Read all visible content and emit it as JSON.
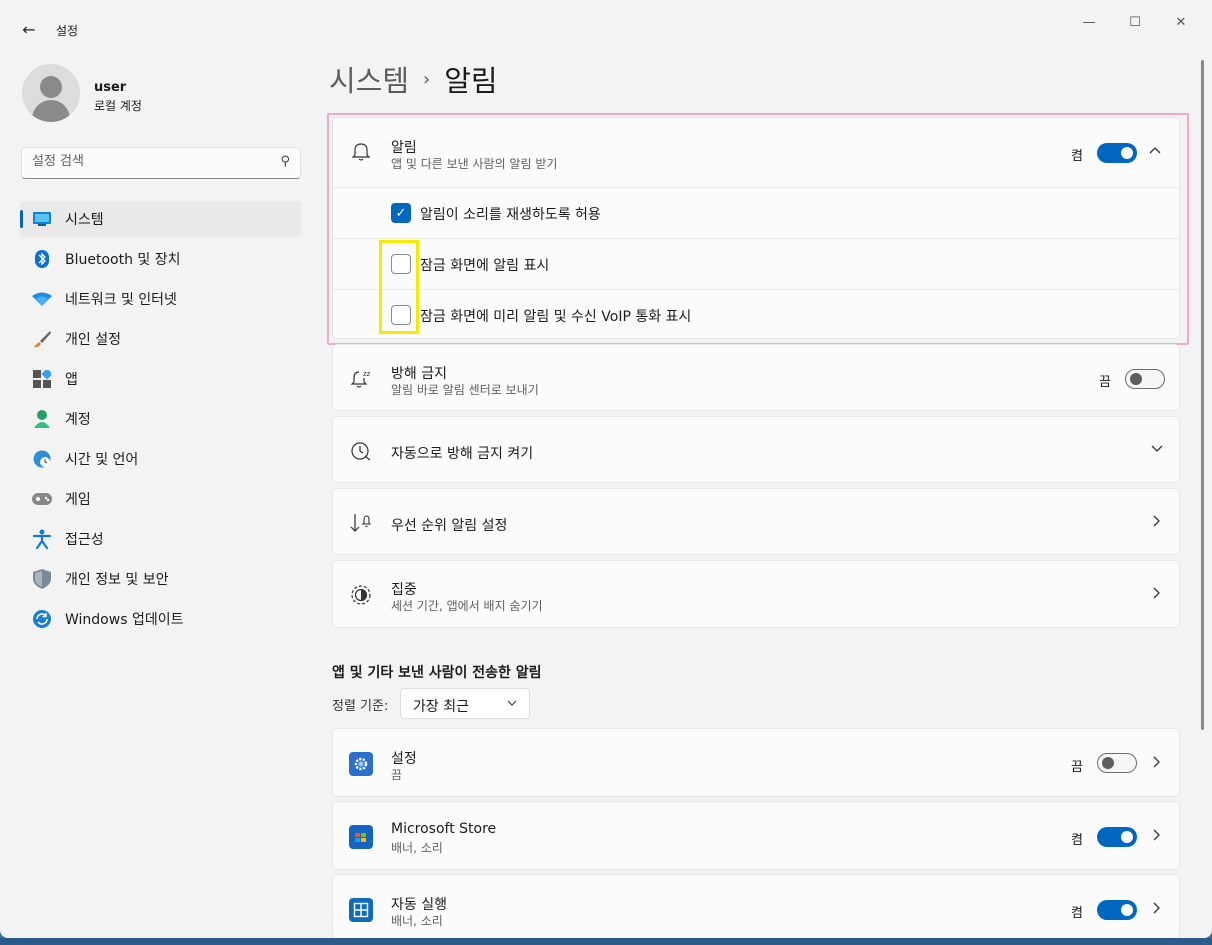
{
  "window": {
    "title": "설정",
    "controls": [
      "—",
      "☐",
      "✕"
    ]
  },
  "profile": {
    "name": "user",
    "account_type": "로컬 계정"
  },
  "search": {
    "placeholder": "설정 검색"
  },
  "sidebar": {
    "items": [
      {
        "label": "시스템",
        "icon": "system-display-icon",
        "active": true
      },
      {
        "label": "Bluetooth 및 장치",
        "icon": "bluetooth-icon"
      },
      {
        "label": "네트워크 및 인터넷",
        "icon": "wifi-icon"
      },
      {
        "label": "개인 설정",
        "icon": "brush-icon"
      },
      {
        "label": "앱",
        "icon": "apps-icon"
      },
      {
        "label": "계정",
        "icon": "account-icon"
      },
      {
        "label": "시간 및 언어",
        "icon": "time-language-icon"
      },
      {
        "label": "게임",
        "icon": "gamepad-icon"
      },
      {
        "label": "접근성",
        "icon": "accessibility-icon"
      },
      {
        "label": "개인 정보 및 보안",
        "icon": "shield-icon"
      },
      {
        "label": "Windows 업데이트",
        "icon": "update-icon"
      }
    ]
  },
  "breadcrumb": {
    "parent": "시스템",
    "separator": "›",
    "current": "알림"
  },
  "notifications": {
    "title": "알림",
    "subtitle": "앱 및 다른 보낸 사람의 알림 받기",
    "state": "켬",
    "options": [
      {
        "label": "알림이 소리를 재생하도록 허용",
        "checked": true
      },
      {
        "label": "잠금 화면에 알림 표시",
        "checked": false
      },
      {
        "label": "잠금 화면에 미리 알림 및 수신 VoIP 통화 표시",
        "checked": false
      }
    ]
  },
  "do_not_disturb": {
    "title": "방해 금지",
    "subtitle": "알림 바로 알림 센터로 보내기",
    "state": "끔"
  },
  "auto_dnd": {
    "title": "자동으로 방해 금지 켜기"
  },
  "priority": {
    "title": "우선 순위 알림 설정"
  },
  "focus": {
    "title": "집중",
    "subtitle": "세션 기간, 앱에서 배지 숨기기"
  },
  "apps_section": {
    "title": "앱 및 기타 보낸 사람이 전송한 알림",
    "sort_label": "정렬 기준:",
    "sort_value": "가장 최근",
    "apps": [
      {
        "name": "설정",
        "detail": "끔",
        "state": "끔",
        "on": false
      },
      {
        "name": "Microsoft Store",
        "detail": "배너, 소리",
        "state": "켬",
        "on": true
      },
      {
        "name": "자동 실행",
        "detail": "배너, 소리",
        "state": "켬",
        "on": true
      }
    ]
  },
  "colors": {
    "accent": "#0067c0",
    "highlight_pink": "#f0a9c8",
    "highlight_yellow": "#f5eb00"
  }
}
